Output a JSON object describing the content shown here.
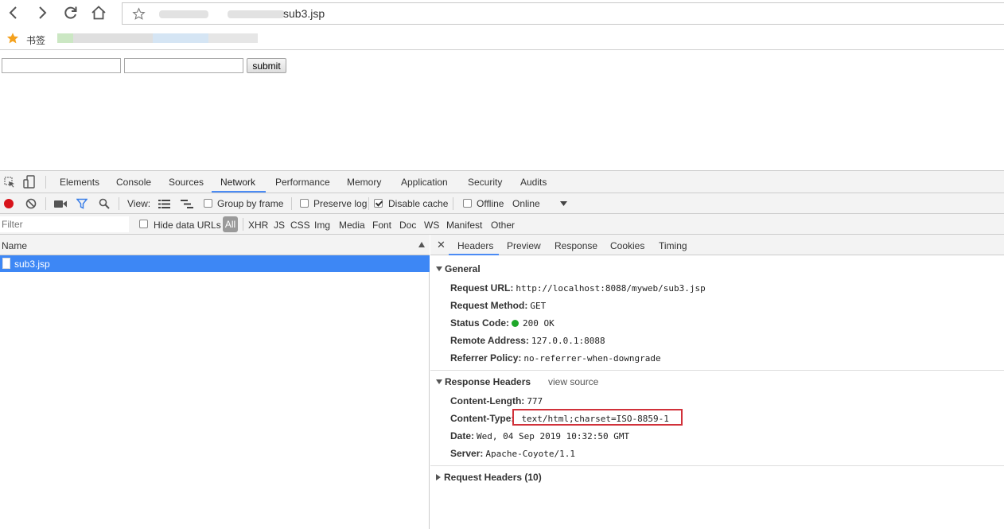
{
  "browser": {
    "url_visible_tail": "sub3.jsp",
    "bookmarks_label": "书签"
  },
  "page": {
    "submit_label": "submit"
  },
  "devtools": {
    "tabs": [
      "Elements",
      "Console",
      "Sources",
      "Network",
      "Performance",
      "Memory",
      "Application",
      "Security",
      "Audits"
    ],
    "active_tab": "Network",
    "toolbar": {
      "view_label": "View:",
      "group_by_frame": "Group by frame",
      "preserve_log": "Preserve log",
      "disable_cache": "Disable cache",
      "offline": "Offline",
      "throttling": "Online"
    },
    "filter": {
      "placeholder": "Filter",
      "hide_data_urls": "Hide data URLs",
      "types": [
        "All",
        "XHR",
        "JS",
        "CSS",
        "Img",
        "Media",
        "Font",
        "Doc",
        "WS",
        "Manifest",
        "Other"
      ]
    },
    "requests": {
      "column_name": "Name",
      "items": [
        "sub3.jsp"
      ]
    },
    "detail": {
      "tabs": [
        "Headers",
        "Preview",
        "Response",
        "Cookies",
        "Timing"
      ],
      "active_tab": "Headers",
      "general": {
        "title": "General",
        "rows": [
          {
            "key": "Request URL:",
            "value": "http://localhost:8088/myweb/sub3.jsp"
          },
          {
            "key": "Request Method:",
            "value": "GET"
          },
          {
            "key": "Status Code:",
            "value": "200 OK"
          },
          {
            "key": "Remote Address:",
            "value": "127.0.0.1:8088"
          },
          {
            "key": "Referrer Policy:",
            "value": "no-referrer-when-downgrade"
          }
        ]
      },
      "response_headers": {
        "title": "Response Headers",
        "view_source": "view source",
        "rows": [
          {
            "key": "Content-Length:",
            "value": "777"
          },
          {
            "key": "Content-Type:",
            "value": "text/html;charset=ISO-8859-1"
          },
          {
            "key": "Date:",
            "value": "Wed, 04 Sep 2019 10:32:50 GMT"
          },
          {
            "key": "Server:",
            "value": "Apache-Coyote/1.1"
          }
        ]
      },
      "request_headers": {
        "title": "Request Headers (10)"
      }
    }
  },
  "colors": {
    "selected_row": "#3d87f5",
    "tab_underline": "#4b8bf4",
    "status_ok": "#1fa82a",
    "highlight": "#d1313a",
    "record": "#d8131b"
  }
}
